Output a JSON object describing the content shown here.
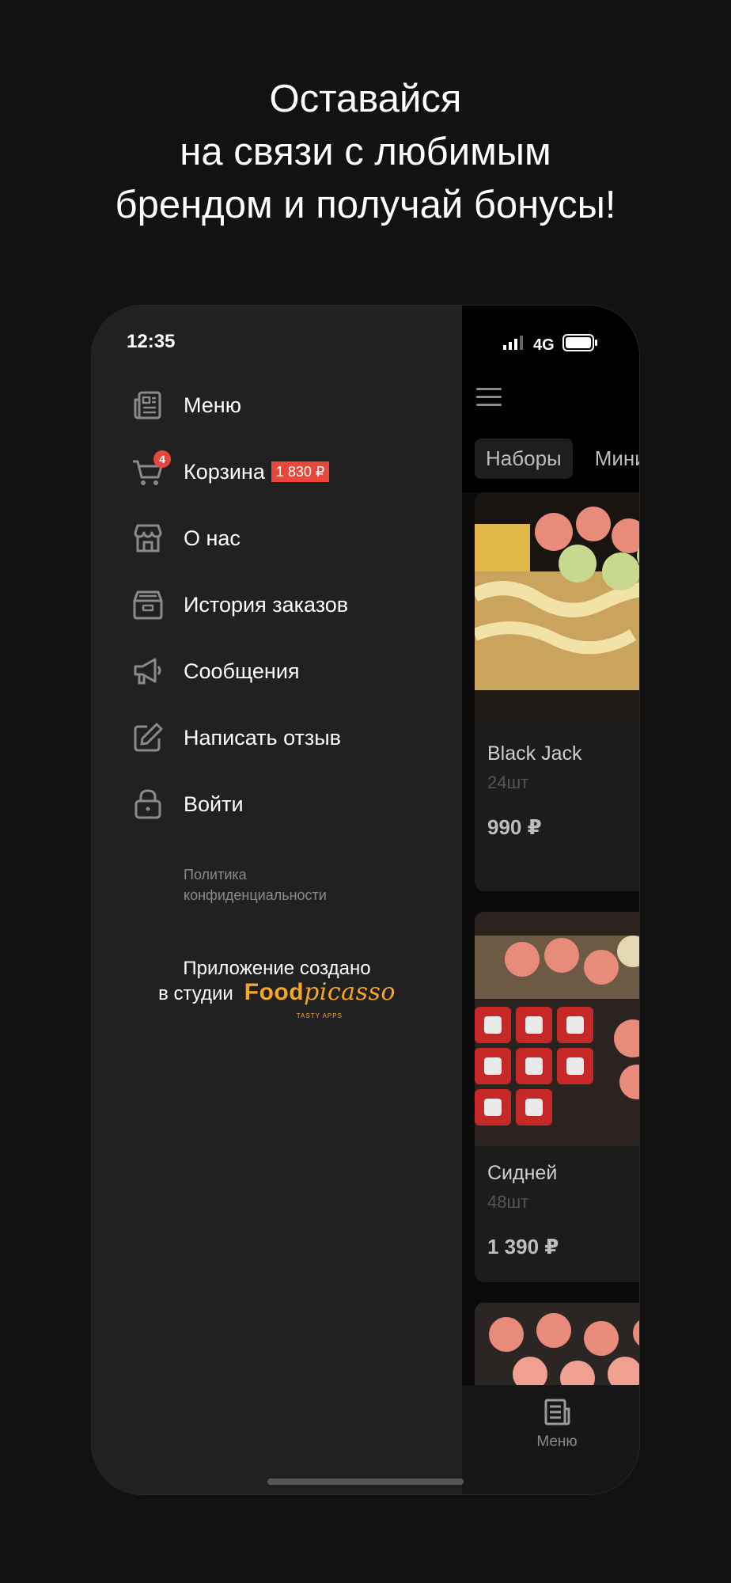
{
  "headline": {
    "line1": "Оставайся",
    "line2": "на связи с любимым",
    "line3": "брендом и получай бонусы!"
  },
  "status_bar": {
    "time": "12:35",
    "network": "4G"
  },
  "drawer": {
    "items": [
      {
        "label": "Меню",
        "icon": "newspaper-icon"
      },
      {
        "label": "Корзина",
        "icon": "cart-icon",
        "badge_count": "4",
        "price_badge": "1 830 ₽"
      },
      {
        "label": "О нас",
        "icon": "store-icon"
      },
      {
        "label": "История заказов",
        "icon": "archive-icon"
      },
      {
        "label": "Сообщения",
        "icon": "megaphone-icon"
      },
      {
        "label": "Написать отзыв",
        "icon": "pencil-icon"
      },
      {
        "label": "Войти",
        "icon": "lock-icon"
      }
    ],
    "privacy_line1": "Политика",
    "privacy_line2": "конфиденциальности",
    "credits_line1": "Приложение создано",
    "credits_line2": "в студии",
    "brand_part1": "Food",
    "brand_part2": "picasso",
    "brand_tagline": "TASTY APPS"
  },
  "app": {
    "tabs": [
      "Наборы",
      "Мини"
    ],
    "products": [
      {
        "name": "Black Jack",
        "qty": "24шт",
        "price": "990 ₽"
      },
      {
        "name": "Сидней",
        "qty": "48шт",
        "price": "1 390 ₽"
      }
    ],
    "bottom_nav_label": "Меню"
  },
  "colors": {
    "background": "#121212",
    "drawer": "#212121",
    "accent_red": "#e8473b",
    "brand_orange": "#f5a623"
  }
}
